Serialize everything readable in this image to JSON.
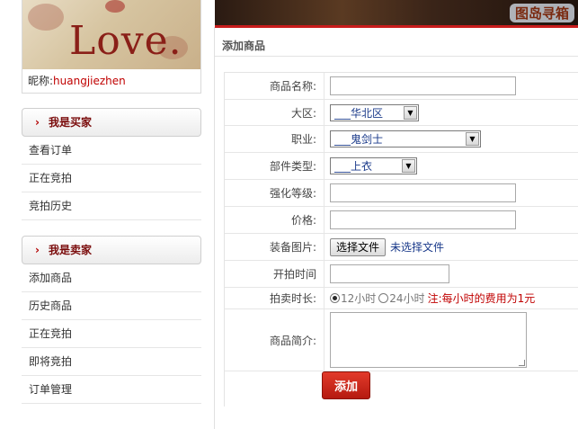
{
  "profile": {
    "avatar_text": "Love.",
    "nickname_label": "昵称:",
    "nickname": "huangjiezhen"
  },
  "sidebar": {
    "buyer": {
      "title": "我是买家",
      "items": [
        "查看订单",
        "正在竞拍",
        "竞拍历史"
      ]
    },
    "seller": {
      "title": "我是卖家",
      "items": [
        "添加商品",
        "历史商品",
        "正在竞拍",
        "即将竞拍",
        "订单管理"
      ]
    }
  },
  "banner": {
    "text": "图岛寻箱"
  },
  "page": {
    "title": "添加商品"
  },
  "form": {
    "name_label": "商品名称:",
    "name_value": "",
    "region_label": "大区:",
    "region_value": "___华北区",
    "job_label": "职业:",
    "job_value": "___鬼剑士",
    "part_label": "部件类型:",
    "part_value": "___上衣",
    "enhance_label": "强化等级:",
    "enhance_value": "",
    "price_label": "价格:",
    "price_value": "",
    "image_label": "装备图片:",
    "file_button": "选择文件",
    "file_status": "未选择文件",
    "start_label": "开拍时间",
    "start_value": "",
    "duration_label": "拍卖时长:",
    "duration_options": [
      "12小时",
      "24小时"
    ],
    "duration_selected": "12小时",
    "duration_note": "注:每小时的费用为1元",
    "desc_label": "商品简介:",
    "desc_value": ""
  },
  "submit_label": "添加",
  "colors": {
    "accent_red": "#c81c1c",
    "link_red": "#c00000",
    "select_text": "#1a3a8a"
  }
}
